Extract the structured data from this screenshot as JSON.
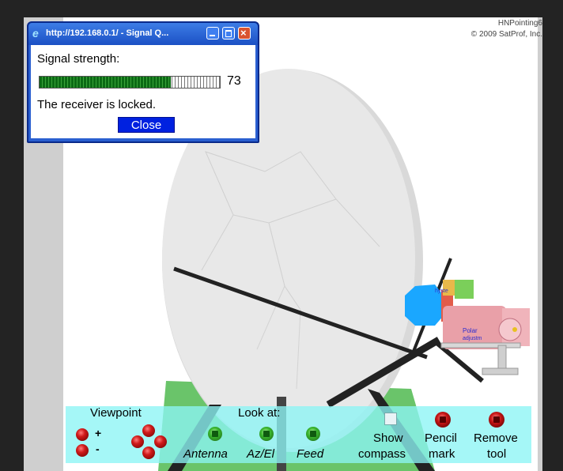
{
  "brand": {
    "product": "HNPointing6",
    "copyright": "© 2009 SatProf, Inc."
  },
  "popup": {
    "title": "http://192.168.0.1/ - Signal Q...",
    "signal_label": "Signal strength:",
    "signal_value": "73",
    "signal_fraction": 0.73,
    "status": "The receiver is locked.",
    "close_label": "Close"
  },
  "scene": {
    "labels": {
      "polar": "Polar",
      "adjust": "adjustm",
      "hint": "hyste"
    }
  },
  "toolbar": {
    "viewpoint_label": "Viewpoint",
    "plus": "+",
    "minus": "-",
    "lookat_label": "Look at:",
    "antenna": "Antenna",
    "azel": "Az/El",
    "feed": "Feed",
    "show_line1": "Show",
    "show_line2": "compass",
    "pencil_line1": "Pencil",
    "pencil_line2": "mark",
    "remove_line1": "Remove",
    "remove_line2": "tool"
  },
  "colors": {
    "toolbar_bg": "#8cf5f5",
    "dish": "#e6e6e6",
    "feed_blue": "#1aa7ff",
    "pink": "#e9a0a8",
    "close_btn": "#0021e0"
  },
  "icons": {
    "ie": "ie-icon",
    "minimize": "minimize-icon",
    "maximize": "maximize-icon",
    "close": "close-icon"
  }
}
